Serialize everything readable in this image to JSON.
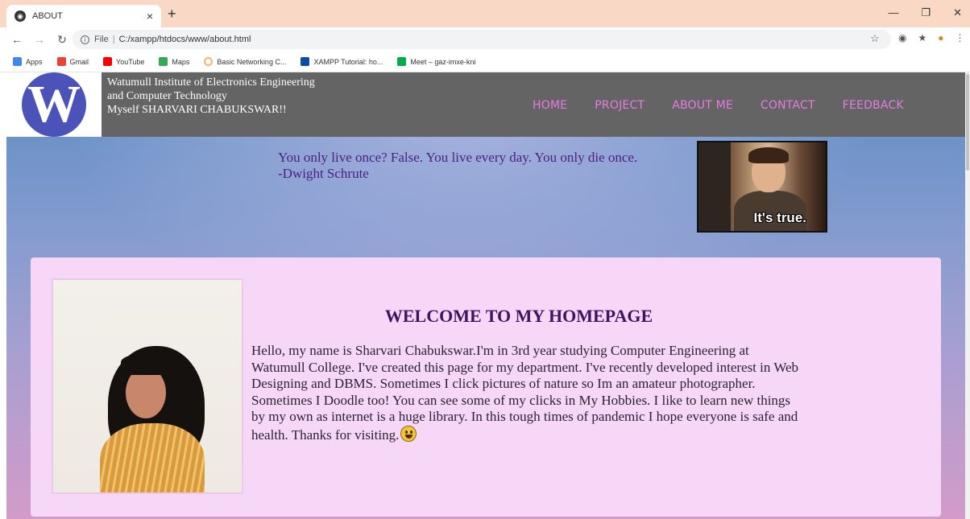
{
  "browser": {
    "tab_title": "ABOUT",
    "tab_close": "×",
    "new_tab": "+",
    "url_scheme": "File",
    "url_path": "C:/xampp/htdocs/www/about.html",
    "bookmarks": [
      {
        "label": "Apps",
        "icon": "apps-grid-icon",
        "color": "#4285f4"
      },
      {
        "label": "Gmail",
        "icon": "gmail-icon",
        "color": "#ea4335"
      },
      {
        "label": "YouTube",
        "icon": "youtube-icon",
        "color": "#ff0000"
      },
      {
        "label": "Maps",
        "icon": "maps-icon",
        "color": "#34a853"
      },
      {
        "label": "Basic Networking C...",
        "icon": "loading-ring-icon",
        "color": "#f6b26b"
      },
      {
        "label": "XAMPP Tutorial: ho...",
        "icon": "xampp-icon",
        "color": "#0b4fa5"
      },
      {
        "label": "Meet – gaz-imxe-kni",
        "icon": "meet-icon",
        "color": "#00ac47"
      }
    ]
  },
  "site": {
    "logo_letter": "W",
    "title_line1": "Watumull Institute of Electronics Engineering",
    "title_line2": "and Computer Technology",
    "title_line3": "Myself SHARVARI CHABUKSWAR!!",
    "nav": [
      "HOME",
      "PROJECT",
      "ABOUT ME",
      "CONTACT",
      "FEEDBACK"
    ],
    "nav_color": "#e97be0",
    "header_color": "#646464"
  },
  "quote": {
    "line1": "You only live once? False. You live every day. You only die once.",
    "line2": "-Dwight Schrute",
    "gif_caption": "It's true."
  },
  "card": {
    "heading": "WELCOME TO MY HOMEPAGE",
    "paragraph": "Hello, my name is Sharvari Chabukswar.I'm in 3rd year studying Computer Engineering at Watumull College. I've created this page for my department. I've recently developed interest in Web Designing and DBMS. Sometimes I click pictures of nature so Im an amateur photographer. Sometimes I Doodle too! You can see some of my clicks in My Hobbies. I like to learn new things by my own as internet is a huge library. In this tough times of pandemic I hope everyone is safe and health. Thanks for visiting.",
    "background": "#f7d7f7"
  }
}
